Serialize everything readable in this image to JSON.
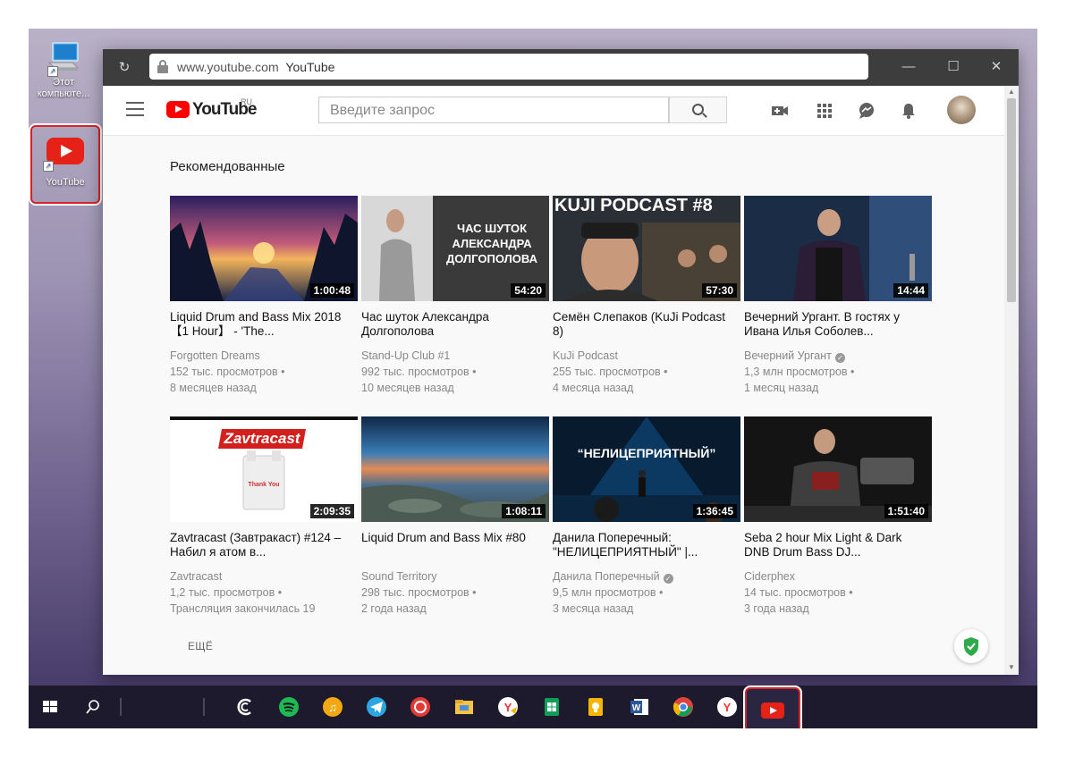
{
  "desktop": {
    "icons": [
      {
        "label": "Этот компьюте..."
      },
      {
        "label": "YouTube"
      }
    ]
  },
  "browser": {
    "url_host": "www.youtube.com",
    "url_title": "YouTube"
  },
  "youtube": {
    "logo_text": "YouTube",
    "logo_region": "RU",
    "search_placeholder": "Введите запрос",
    "section_title": "Рекомендованные",
    "more_label": "ЕЩЁ",
    "videos": [
      {
        "title": "Liquid Drum and Bass Mix 2018 【1 Hour】 - 'The...",
        "channel": "Forgotten Dreams",
        "views": "152 тыс. просмотров •",
        "age": "8 месяцев назад",
        "duration": "1:00:48",
        "verified": false
      },
      {
        "title": "Час шуток Александра Долгополова",
        "channel": "Stand-Up Club #1",
        "views": "992 тыс. просмотров •",
        "age": "10 месяцев назад",
        "duration": "54:20",
        "verified": false,
        "thumb_text": "ЧАС ШУТОК АЛЕКСАНДРА ДОЛГОПОЛОВА"
      },
      {
        "title": "Семён Слепаков (KuJi Podcast 8)",
        "channel": "KuJi Podcast",
        "views": "255 тыс. просмотров •",
        "age": "4 месяца назад",
        "duration": "57:30",
        "verified": false,
        "thumb_text": "KUJI PODCAST #8"
      },
      {
        "title": "Вечерний Ургант. В гостях у Ивана Илья Соболев...",
        "channel": "Вечерний Ургант",
        "views": "1,3 млн просмотров •",
        "age": "1 месяц назад",
        "duration": "14:44",
        "verified": true
      },
      {
        "title": "Zavtracast (Завтракаст) #124 – Набил я атом в...",
        "channel": "Zavtracast",
        "views": "1,2 тыс. просмотров •",
        "age": "Трансляция закончилась 19",
        "duration": "2:09:35",
        "verified": false,
        "thumb_text": "Zavtracast",
        "thumb_text2": "Thank You"
      },
      {
        "title": "Liquid Drum and Bass Mix #80",
        "channel": "Sound Territory",
        "views": "298 тыс. просмотров •",
        "age": "2 года назад",
        "duration": "1:08:11",
        "verified": false
      },
      {
        "title": "Данила Поперечный: \"НЕЛИЦЕПРИЯТНЫЙ\" |...",
        "channel": "Данила Поперечный",
        "views": "9,5 млн просмотров •",
        "age": "3 месяца назад",
        "duration": "1:36:45",
        "verified": true,
        "thumb_text": "“НЕЛИЦЕПРИЯТНЫЙ”"
      },
      {
        "title": "Seba 2 hour Mix Light & Dark DNB Drum Bass DJ...",
        "channel": "Ciderphex",
        "views": "14 тыс. просмотров •",
        "age": "3 года назад",
        "duration": "1:51:40",
        "verified": false
      }
    ]
  },
  "taskbar": {
    "items": [
      "windows-start",
      "search",
      "cortana",
      "spotify",
      "music-player",
      "telegram",
      "app-red",
      "file-explorer",
      "yandex-browser",
      "google-sheets",
      "notes",
      "word",
      "chrome",
      "yandex-browser-2",
      "youtube"
    ]
  }
}
